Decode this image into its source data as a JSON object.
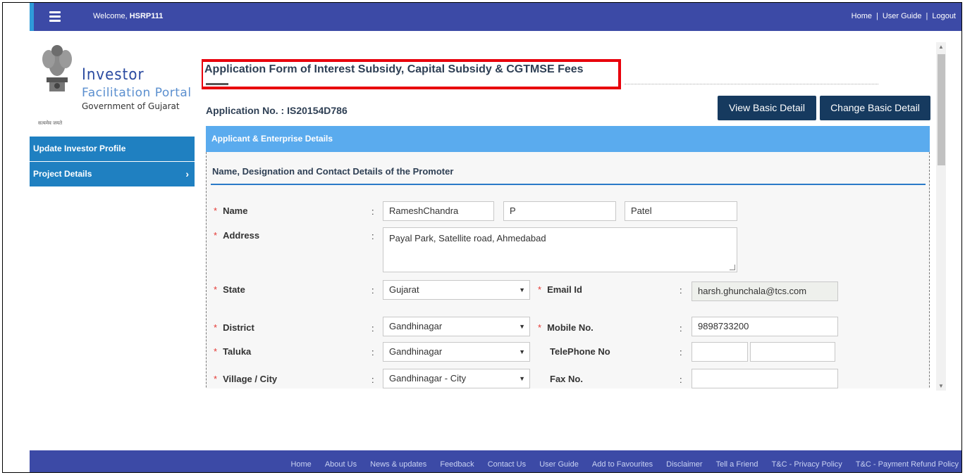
{
  "header": {
    "welcome_label": "Welcome,",
    "username": "HSRP111",
    "links": [
      "Home",
      "User Guide",
      "Logout"
    ],
    "separator": "|"
  },
  "logo": {
    "line1": "Investor",
    "line2": "Facilitation Portal",
    "line3": "Government of Gujarat",
    "motto": "सत्यमेव जयते"
  },
  "sidebar": {
    "items": [
      {
        "label": "Update Investor Profile"
      },
      {
        "label": "Project Details",
        "chevron": "›"
      }
    ]
  },
  "main": {
    "title": "Application Form of Interest Subsidy, Capital Subsidy & CGTMSE Fees",
    "application_no": "Application No. : IS20154D786",
    "view_button": "View Basic Detail",
    "change_button": "Change Basic Detail",
    "section_title": "Applicant & Enterprise Details",
    "subsection_title": "Name, Designation and Contact Details of the Promoter"
  },
  "form": {
    "required_mark": "*",
    "colon": ":",
    "name_label": "Name",
    "first_name": "RameshChandra",
    "middle_name": "P",
    "last_name": "Patel",
    "address_label": "Address",
    "address_value": "Payal Park, Satellite road, Ahmedabad",
    "state_label": "State",
    "state_value": "Gujarat",
    "email_label": "Email Id",
    "email_value": "harsh.ghunchala@tcs.com",
    "district_label": "District",
    "district_value": "Gandhinagar",
    "mobile_label": "Mobile No.",
    "mobile_value": "9898733200",
    "taluka_label": "Taluka",
    "taluka_value": "Gandhinagar",
    "telephone_label": "TelePhone No",
    "telephone_code": "",
    "telephone_number": "",
    "village_label": "Village / City",
    "village_value": "Gandhinagar - City",
    "fax_label": "Fax No.",
    "fax_value": "",
    "dropdown_arrow": "▼"
  },
  "footer": {
    "links": [
      "Home",
      "About Us",
      "News & updates",
      "Feedback",
      "Contact Us",
      "User Guide",
      "Add to Favourites",
      "Disclaimer",
      "Tell a Friend",
      "T&C - Privacy Policy",
      "T&C - Payment Refund Policy"
    ]
  },
  "colors": {
    "topbar": "#3c4aa6",
    "sidebar_item": "#1f80c1",
    "section_bar": "#5aabee",
    "button": "#163a5f",
    "highlight": "#e8000c"
  }
}
